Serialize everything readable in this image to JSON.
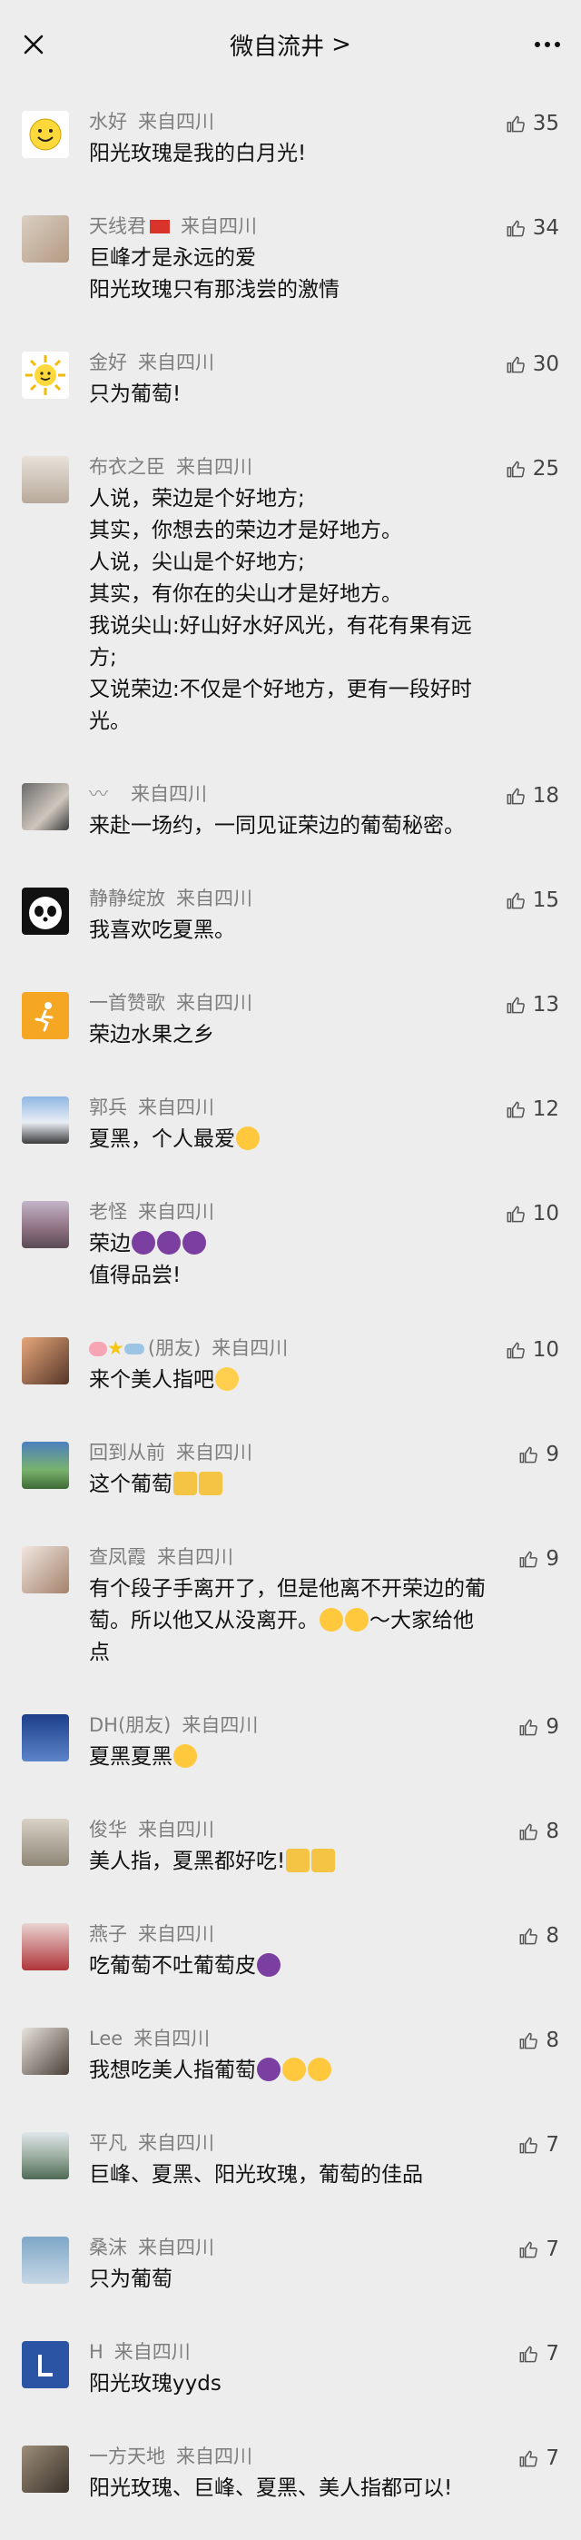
{
  "header": {
    "title": "微自流井",
    "chevron": ">"
  },
  "colors": {
    "background": "#ededed",
    "meta": "#7e7e7e",
    "text": "#111111"
  },
  "comments": [
    {
      "name": "水好",
      "location": "来自四川",
      "likes": "35",
      "lines": [
        "阳光玫瑰是我的白月光!"
      ]
    },
    {
      "name": "天线君",
      "location": "来自四川",
      "likes": "34",
      "lines": [
        "巨峰才是永远的爱",
        "阳光玫瑰只有那浅尝的激情"
      ]
    },
    {
      "name": "金好",
      "location": "来自四川",
      "likes": "30",
      "lines": [
        "只为葡萄!"
      ]
    },
    {
      "name": "布衣之臣",
      "location": "来自四川",
      "likes": "25",
      "lines": [
        "人说，荣边是个好地方;",
        "其实，你想去的荣边才是好地方。",
        "人说，尖山是个好地方;",
        "其实，有你在的尖山才是好地方。",
        "我说尖山:好山好水好风光，有花有果有远",
        "方;",
        "又说荣边:不仅是个好地方，更有一段好时",
        "光。"
      ]
    },
    {
      "name": "",
      "location": "来自四川",
      "likes": "18",
      "lines": [
        "来赴一场约，一同见证荣边的葡萄秘密。"
      ]
    },
    {
      "name": "静静绽放",
      "location": "来自四川",
      "likes": "15",
      "lines": [
        "我喜欢吃夏黑。"
      ]
    },
    {
      "name": "一首赞歌",
      "location": "来自四川",
      "likes": "13",
      "lines": [
        "荣边水果之乡"
      ]
    },
    {
      "name": "郭兵",
      "location": "来自四川",
      "likes": "12",
      "lines": [
        "夏黑，个人最爱"
      ]
    },
    {
      "name": "老怪",
      "location": "来自四川",
      "likes": "10",
      "lines": [
        "荣边",
        "值得品尝!"
      ]
    },
    {
      "name": "(朋友)",
      "location": "来自四川",
      "likes": "10",
      "lines": [
        "来个美人指吧"
      ]
    },
    {
      "name": "回到从前",
      "location": "来自四川",
      "likes": "9",
      "lines": [
        "这个葡萄"
      ]
    },
    {
      "name": "查凤霞",
      "location": "来自四川",
      "likes": "9",
      "lines": [
        "有个段子手离开了，但是他离不开荣边的葡",
        "萄。所以他又从没离开。",
        "点"
      ]
    },
    {
      "name": "DH(朋友)",
      "location": "来自四川",
      "likes": "9",
      "lines": [
        "夏黑夏黑"
      ]
    },
    {
      "name": "俊华",
      "location": "来自四川",
      "likes": "8",
      "lines": [
        "美人指，夏黑都好吃!"
      ]
    },
    {
      "name": "燕子",
      "location": "来自四川",
      "likes": "8",
      "lines": [
        "吃葡萄不吐葡萄皮"
      ]
    },
    {
      "name": "Lee",
      "location": "来自四川",
      "likes": "8",
      "lines": [
        "我想吃美人指葡萄"
      ]
    },
    {
      "name": "平凡",
      "location": "来自四川",
      "likes": "7",
      "lines": [
        "巨峰、夏黑、阳光玫瑰，葡萄的佳品"
      ]
    },
    {
      "name": "桑沫",
      "location": "来自四川",
      "likes": "7",
      "lines": [
        "只为葡萄"
      ]
    },
    {
      "name": "H",
      "location": "来自四川",
      "likes": "7",
      "lines": [
        "阳光玫瑰yyds"
      ]
    },
    {
      "name": "一方天地",
      "location": "来自四川",
      "likes": "7",
      "lines": [
        "阳光玫瑰、巨峰、夏黑、美人指都可以!"
      ]
    }
  ],
  "extras": {
    "c8_tail": "～大家给他"
  }
}
